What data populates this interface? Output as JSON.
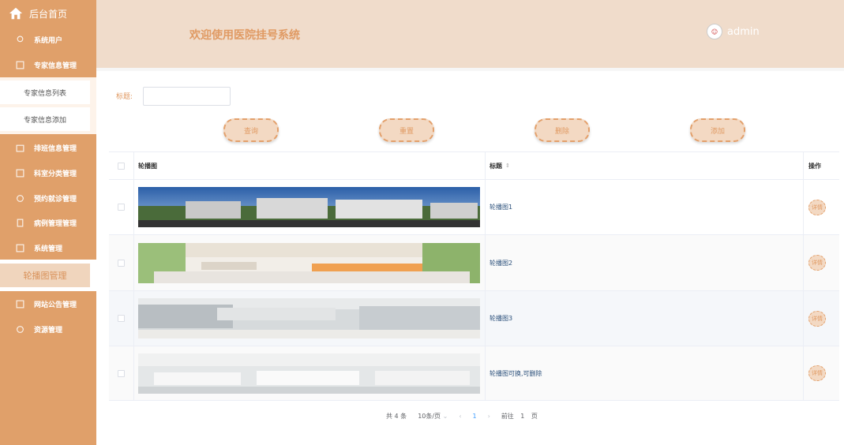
{
  "sidebar": {
    "home": "后台首页",
    "items": [
      {
        "label": "系统用户",
        "icon": "user-icon"
      },
      {
        "label": "专家信息管理",
        "icon": "expert-icon"
      },
      {
        "label": "排班信息管理",
        "icon": "schedule-icon"
      },
      {
        "label": "科室分类管理",
        "icon": "department-icon"
      },
      {
        "label": "预约就诊管理",
        "icon": "appointment-icon"
      },
      {
        "label": "病例管理管理",
        "icon": "case-icon"
      },
      {
        "label": "系统管理",
        "icon": "system-icon"
      },
      {
        "label": "网站公告管理",
        "icon": "notice-icon"
      },
      {
        "label": "资源管理",
        "icon": "resource-icon"
      }
    ],
    "sub_items": [
      "专家信息列表",
      "专家信息添加"
    ],
    "active": "轮播图管理"
  },
  "header": {
    "title": "欢迎使用医院挂号系统",
    "user": "admin"
  },
  "search": {
    "label": "标题:",
    "value": ""
  },
  "buttons": {
    "query": "查询",
    "reset": "重置",
    "delete": "删除",
    "add": "添加"
  },
  "table": {
    "headers": {
      "image": "轮播图",
      "title": "标题",
      "op": "操作"
    },
    "rows": [
      {
        "title": "轮播图1",
        "detail": "详情"
      },
      {
        "title": "轮播图2",
        "detail": "详情"
      },
      {
        "title": "轮播图3",
        "detail": "详情"
      },
      {
        "title": "轮播图可换,可删除",
        "detail": "详情"
      }
    ]
  },
  "pager": {
    "total": "共 4 条",
    "size": "10条/页",
    "current": "1",
    "goto_label": "前往",
    "goto_value": "1",
    "page_unit": "页"
  },
  "colors": {
    "sidebar": "#e0a06a",
    "header_bg": "#f0dccb",
    "accent": "#e09a63"
  }
}
